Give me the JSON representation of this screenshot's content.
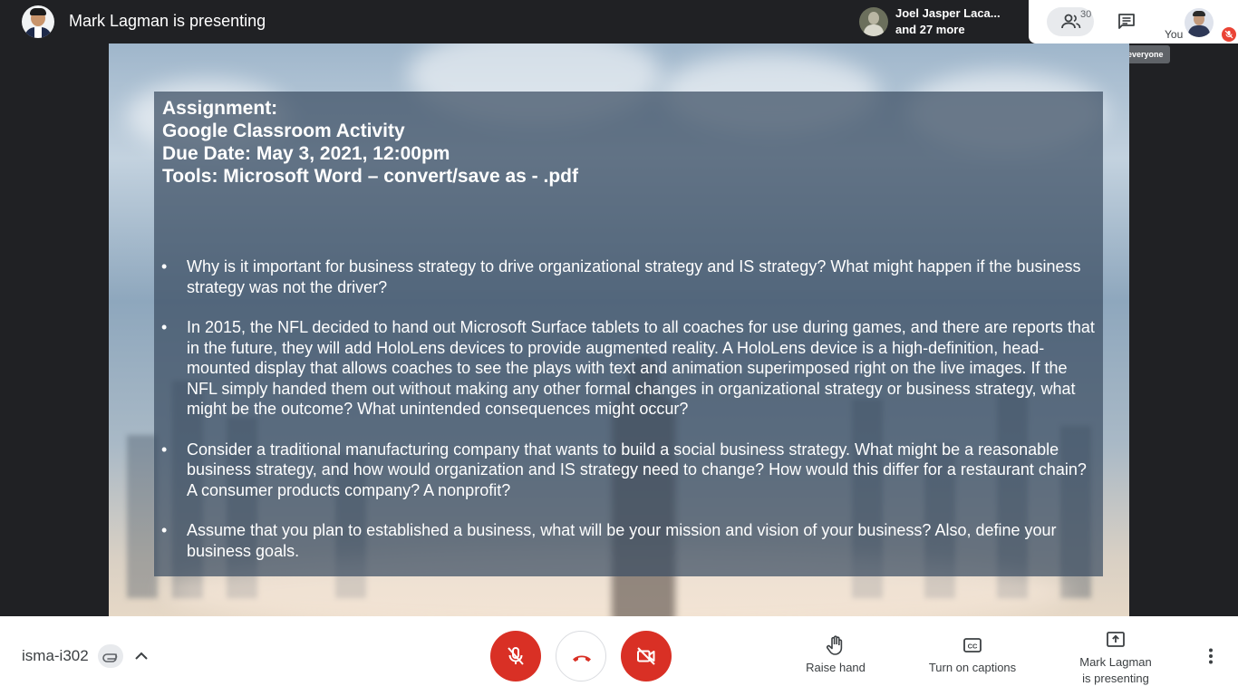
{
  "header": {
    "presenting_title": "Mark Lagman is presenting",
    "participant_name": "Joel Jasper Laca...",
    "participant_more": "and 27 more",
    "people_count": "30",
    "you_label": "You",
    "tooltip": "Chat with everyone"
  },
  "slide": {
    "heading_lines": [
      "Assignment:",
      "Google Classroom Activity",
      "Due Date: May 3, 2021, 12:00pm",
      "Tools: Microsoft Word – convert/save as - .pdf"
    ],
    "bullets": [
      "Why is it important for business strategy to drive organizational strategy and IS strategy? What might happen if the business strategy was not the driver?",
      "In 2015, the NFL decided to hand out Microsoft Surface tablets to all coaches for use during games, and there are reports that in the future, they will add HoloLens devices to provide augmented reality. A HoloLens device is a high-definition, head-mounted display that allows coaches to see the plays with text and animation superimposed right on the live images. If the NFL simply handed them out without making any other formal changes in organizational strategy or business strategy, what might be the outcome? What unintended consequences might occur?",
      "Consider a traditional manufacturing company that wants to build a social business strategy. What might be a reasonable business strategy, and how would organization and IS strategy need to change? How would this differ for a restaurant chain? A consumer products company? A nonprofit?",
      "Assume that you plan to established a business, what will be your mission and vision of your business? Also, define your business goals."
    ],
    "bullet_symbol": "•"
  },
  "footer": {
    "meeting_code": "isma-i302",
    "raise_hand_label": "Raise hand",
    "captions_label": "Turn on captions",
    "presenting_line1": "Mark Lagman",
    "presenting_line2": "is presenting"
  },
  "icons": {
    "people": "people-icon",
    "chat": "chat-icon",
    "mic_muted": "mic-off-icon",
    "hangup": "call-end-icon",
    "camera_off": "videocam-off-icon",
    "raise_hand": "hand-icon",
    "captions": "closed-caption-icon",
    "present": "present-screen-icon",
    "more": "more-vert-icon",
    "attachment": "attachment-icon",
    "chevron": "chevron-up-icon"
  },
  "colors": {
    "danger_red": "#d93025",
    "dark_bg": "#202124",
    "slide_overlay": "#3c4e62"
  }
}
